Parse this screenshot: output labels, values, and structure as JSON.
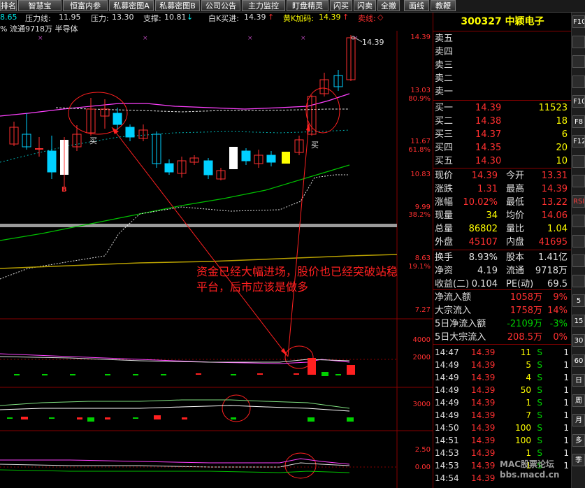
{
  "toolbar": {
    "buttons": [
      "排名",
      "智慧宝",
      "恒富内参",
      "私募密图A",
      "私募密图B",
      "公司公告",
      "主力监控",
      "盯盘精灵",
      "闪买",
      "闪卖",
      "全撤",
      "画线",
      "教鞭"
    ]
  },
  "indicators": {
    "first_value": "8.65",
    "pressure_line_label": "压力线:",
    "pressure_line_value": "11.95",
    "pressure_label": "压力:",
    "pressure_value": "13.30",
    "support_label": "支撑:",
    "support_value": "10.81",
    "white_k_label": "白K买进:",
    "white_k_value": "14.39",
    "yellow_k_label": "黄K加码:",
    "yellow_k_value": "14.39",
    "sell_line_label": "卖线:"
  },
  "info_line": "% 流通9718万 半导体",
  "price_axis": [
    "14.39",
    "13.03",
    "11.67",
    "10.83",
    "9.99",
    "8.63",
    "7.27"
  ],
  "pct_axis": [
    "80.9%",
    "61.8%",
    "38.2%",
    "19.1%"
  ],
  "chart_labels": {
    "last_price": "14.39",
    "buy1": "买",
    "buy2": "买",
    "b_marker": "B"
  },
  "note_text": "资金已经大幅进场，股价也已经突破站稳平台，后市应该是做多",
  "sub_axis": {
    "p1_top": "4000",
    "p1_mid": "2000",
    "p2": "3000",
    "p3_top": "2.50",
    "p3_mid": "0.00"
  },
  "stock": {
    "code": "300327",
    "name": "中颖电子"
  },
  "order_book": {
    "sell": [
      {
        "label": "卖五",
        "price": "",
        "vol": ""
      },
      {
        "label": "卖四",
        "price": "",
        "vol": ""
      },
      {
        "label": "卖三",
        "price": "",
        "vol": ""
      },
      {
        "label": "卖二",
        "price": "",
        "vol": ""
      },
      {
        "label": "卖一",
        "price": "",
        "vol": ""
      }
    ],
    "buy": [
      {
        "label": "买一",
        "price": "14.39",
        "vol": "11523"
      },
      {
        "label": "买二",
        "price": "14.38",
        "vol": "18"
      },
      {
        "label": "买三",
        "price": "14.37",
        "vol": "6"
      },
      {
        "label": "买四",
        "price": "14.35",
        "vol": "20"
      },
      {
        "label": "买五",
        "price": "14.30",
        "vol": "10"
      }
    ]
  },
  "stats": [
    {
      "l1": "现价",
      "v1": "14.39",
      "l2": "今开",
      "v2": "13.31"
    },
    {
      "l1": "涨跌",
      "v1": "1.31",
      "l2": "最高",
      "v2": "14.39"
    },
    {
      "l1": "涨幅",
      "v1": "10.02%",
      "l2": "最低",
      "v2": "13.22"
    },
    {
      "l1": "现量",
      "v1": "34",
      "l2": "均价",
      "v2": "14.06"
    },
    {
      "l1": "总量",
      "v1": "86802",
      "l2": "量比",
      "v2": "1.04"
    },
    {
      "l1": "外盘",
      "v1": "45107",
      "l2": "内盘",
      "v2": "41695"
    }
  ],
  "stats2": [
    {
      "l1": "换手",
      "v1": "8.93%",
      "l2": "股本",
      "v2": "1.41亿"
    },
    {
      "l1": "净资",
      "v1": "4.19",
      "l2": "流通",
      "v2": "9718万"
    },
    {
      "l1": "收益(二)",
      "v1": "0.104",
      "l2": "PE(动)",
      "v2": "69.5"
    }
  ],
  "flows": [
    {
      "label": "净流入额",
      "value": "1058万",
      "pct": "9%"
    },
    {
      "label": "大宗流入",
      "value": "1758万",
      "pct": "14%"
    },
    {
      "label": "5日净流入额",
      "value": "-2109万",
      "pct": "-3%"
    },
    {
      "label": "5日大宗流入",
      "value": "208.5万",
      "pct": "0%"
    }
  ],
  "ticks": [
    {
      "time": "14:47",
      "price": "14.39",
      "vol": "11",
      "dir": "S",
      "n": "1"
    },
    {
      "time": "14:49",
      "price": "14.39",
      "vol": "5",
      "dir": "S",
      "n": "1"
    },
    {
      "time": "14:49",
      "price": "14.39",
      "vol": "4",
      "dir": "S",
      "n": "1"
    },
    {
      "time": "14:49",
      "price": "14.39",
      "vol": "50",
      "dir": "S",
      "n": "1"
    },
    {
      "time": "14:49",
      "price": "14.39",
      "vol": "1",
      "dir": "S",
      "n": "1"
    },
    {
      "time": "14:49",
      "price": "14.39",
      "vol": "7",
      "dir": "S",
      "n": "1"
    },
    {
      "time": "14:50",
      "price": "14.39",
      "vol": "100",
      "dir": "S",
      "n": "1"
    },
    {
      "time": "14:51",
      "price": "14.39",
      "vol": "100",
      "dir": "S",
      "n": "1"
    },
    {
      "time": "14:53",
      "price": "14.39",
      "vol": "1",
      "dir": "S",
      "n": "1"
    },
    {
      "time": "14:53",
      "price": "14.39",
      "vol": "1",
      "dir": "S",
      "n": "1"
    },
    {
      "time": "14:54",
      "price": "14.39",
      "vol": "",
      "dir": "",
      "n": ""
    }
  ],
  "iconbar": [
    "F10",
    "",
    "",
    "",
    "F10",
    "F8",
    "F12",
    "",
    "",
    "RSI",
    "",
    "",
    "",
    "",
    "5",
    "15",
    "30",
    "60",
    "日",
    "周",
    "月",
    "多",
    "季"
  ],
  "watermark": "MAC股票论坛 bbs.macd.cn"
}
